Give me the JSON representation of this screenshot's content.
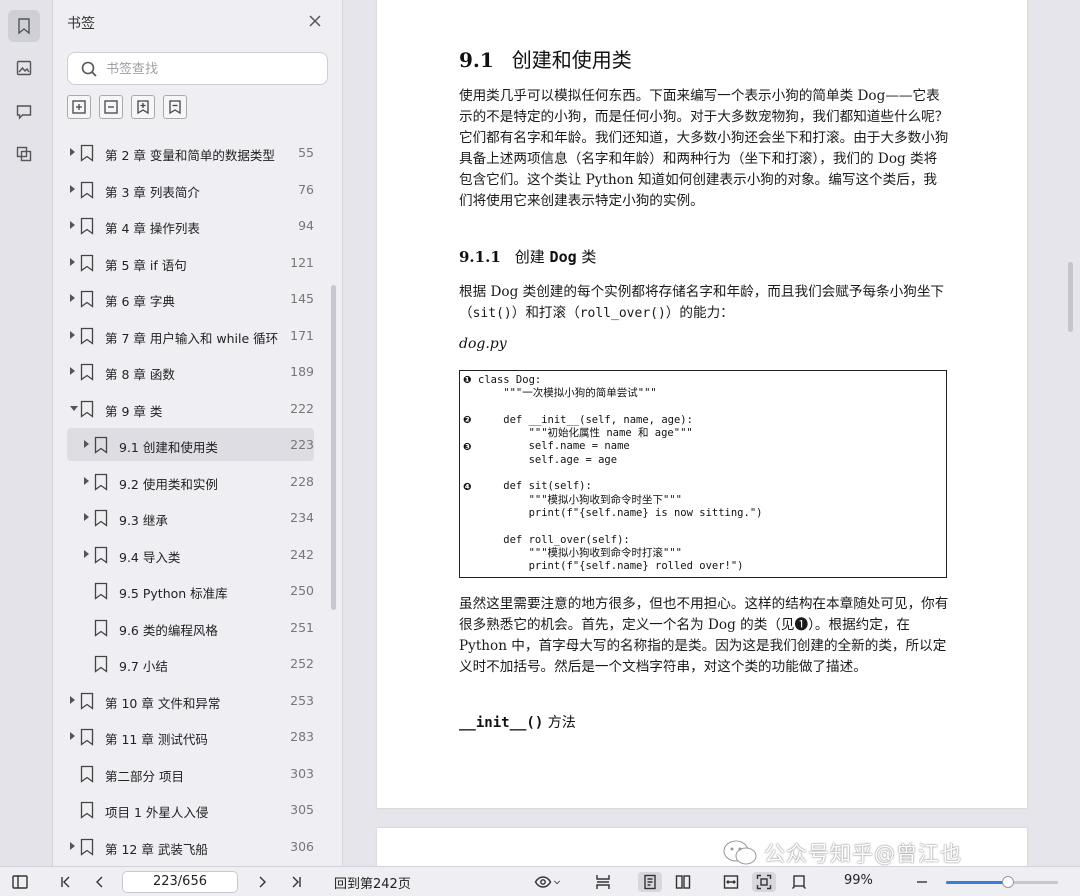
{
  "panel": {
    "title": "书签",
    "search_placeholder": "书签查找"
  },
  "bookmarks": [
    {
      "label": "第 2 章  变量和简单的数据类型",
      "page": "55",
      "level": 0,
      "expandable": true,
      "expanded": false,
      "selected": false
    },
    {
      "label": "第 3 章  列表简介",
      "page": "76",
      "level": 0,
      "expandable": true,
      "expanded": false,
      "selected": false
    },
    {
      "label": "第 4 章  操作列表",
      "page": "94",
      "level": 0,
      "expandable": true,
      "expanded": false,
      "selected": false
    },
    {
      "label": "第 5 章  if 语句",
      "page": "121",
      "level": 0,
      "expandable": true,
      "expanded": false,
      "selected": false
    },
    {
      "label": "第 6 章  字典",
      "page": "145",
      "level": 0,
      "expandable": true,
      "expanded": false,
      "selected": false
    },
    {
      "label": "第 7 章  用户输入和 while 循环",
      "page": "171",
      "level": 0,
      "expandable": true,
      "expanded": false,
      "selected": false
    },
    {
      "label": "第 8 章  函数",
      "page": "189",
      "level": 0,
      "expandable": true,
      "expanded": false,
      "selected": false
    },
    {
      "label": "第 9 章  类",
      "page": "222",
      "level": 0,
      "expandable": true,
      "expanded": true,
      "selected": false
    },
    {
      "label": "9.1 创建和使用类",
      "page": "223",
      "level": 1,
      "expandable": true,
      "expanded": false,
      "selected": true
    },
    {
      "label": "9.2 使用类和实例",
      "page": "228",
      "level": 1,
      "expandable": true,
      "expanded": false,
      "selected": false
    },
    {
      "label": "9.3 继承",
      "page": "234",
      "level": 1,
      "expandable": true,
      "expanded": false,
      "selected": false
    },
    {
      "label": "9.4 导入类",
      "page": "242",
      "level": 1,
      "expandable": true,
      "expanded": false,
      "selected": false
    },
    {
      "label": "9.5 Python 标准库",
      "page": "250",
      "level": 1,
      "expandable": false,
      "expanded": false,
      "selected": false
    },
    {
      "label": "9.6 类的编程风格",
      "page": "251",
      "level": 1,
      "expandable": false,
      "expanded": false,
      "selected": false
    },
    {
      "label": "9.7 小结",
      "page": "252",
      "level": 1,
      "expandable": false,
      "expanded": false,
      "selected": false
    },
    {
      "label": "第 10 章  文件和异常",
      "page": "253",
      "level": 0,
      "expandable": true,
      "expanded": false,
      "selected": false
    },
    {
      "label": "第 11 章  测试代码",
      "page": "283",
      "level": 0,
      "expandable": true,
      "expanded": false,
      "selected": false
    },
    {
      "label": "第二部分  项目",
      "page": "303",
      "level": 0,
      "expandable": false,
      "expanded": false,
      "selected": false
    },
    {
      "label": "项目 1  外星人入侵",
      "page": "305",
      "level": 0,
      "expandable": false,
      "expanded": false,
      "selected": false
    },
    {
      "label": "第 12 章  武装飞船",
      "page": "306",
      "level": 0,
      "expandable": true,
      "expanded": false,
      "selected": false
    }
  ],
  "doc": {
    "h1_num": "9.1",
    "h1_text": "创建和使用类",
    "p1": "使用类几乎可以模拟任何东西。下面来编写一个表示小狗的简单类 Dog——它表示的不是特定的小狗，而是任何小狗。对于大多数宠物狗，我们都知道些什么呢？它们都有名字和年龄。我们还知道，大多数小狗还会坐下和打滚。由于大多数小狗具备上述两项信息（名字和年龄）和两种行为（坐下和打滚），我们的 Dog 类将包含它们。这个类让 Python 知道如何创建表示小狗的对象。编写这个类后，我们将使用它来创建表示特定小狗的实例。",
    "h2_num": "9.1.1",
    "h2_pre": "创建 ",
    "h2_kw": "Dog",
    "h2_post": " 类",
    "p2_a": "根据 Dog 类创建的每个实例都将存储名字和年龄，而且我们会赋予每条小狗坐下（",
    "p2_sit": "sit()",
    "p2_b": "）和打滚（",
    "p2_roll": "roll_over()",
    "p2_c": "）的能力：",
    "filename": "dog.py",
    "code": "class Dog:\n    \"\"\"一次模拟小狗的简单尝试\"\"\"\n\n    def __init__(self, name, age):\n        \"\"\"初始化属性 name 和 age\"\"\"\n        self.name = name\n        self.age = age\n\n    def sit(self):\n        \"\"\"模拟小狗收到命令时坐下\"\"\"\n        print(f\"{self.name} is now sitting.\")\n\n    def roll_over(self):\n        \"\"\"模拟小狗收到命令时打滚\"\"\"\n        print(f\"{self.name} rolled over!\")",
    "markers": [
      "❶",
      "❷",
      "❸",
      "❹"
    ],
    "p3": "虽然这里需要注意的地方很多，但也不用担心。这样的结构在本章随处可见，你有很多熟悉它的机会。首先，定义一个名为 Dog 的类（见❶）。根据约定，在 Python 中，首字母大写的名称指的是类。因为这是我们创建的全新的类，所以定义时不加括号。然后是一个文档字符串，对这个类的功能做了描述。",
    "h3_kw": "__init__()",
    "h3_text": " 方法"
  },
  "watermark": {
    "text": "公众号知乎@曾江也"
  },
  "bottombar": {
    "page_indicator": "223/656",
    "back_to": "回到第242页",
    "zoom": "99%",
    "zoom_fraction": 0.55
  }
}
